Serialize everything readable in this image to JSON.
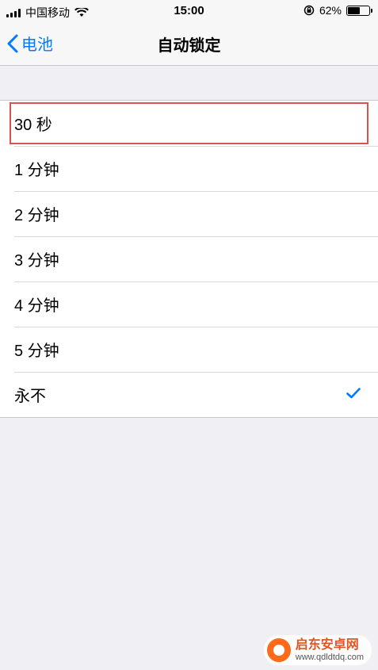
{
  "status_bar": {
    "carrier": "中国移动",
    "time": "15:00",
    "battery_percent_label": "62%",
    "battery_level": 0.62
  },
  "nav": {
    "back_label": "电池",
    "title": "自动锁定"
  },
  "options": [
    {
      "label": "30 秒",
      "selected": false,
      "highlighted": true
    },
    {
      "label": "1 分钟",
      "selected": false,
      "highlighted": false
    },
    {
      "label": "2 分钟",
      "selected": false,
      "highlighted": false
    },
    {
      "label": "3 分钟",
      "selected": false,
      "highlighted": false
    },
    {
      "label": "4 分钟",
      "selected": false,
      "highlighted": false
    },
    {
      "label": "5 分钟",
      "selected": false,
      "highlighted": false
    },
    {
      "label": "永不",
      "selected": true,
      "highlighted": false
    }
  ],
  "watermark": {
    "name": "启东安卓网",
    "url": "www.qdldtdq.com"
  },
  "colors": {
    "accent": "#007aff",
    "highlight_border": "#d9534f",
    "background": "#efeff4"
  },
  "icons": [
    "signal-icon",
    "wifi-icon",
    "orientation-lock-icon",
    "battery-icon",
    "chevron-left-icon",
    "checkmark-icon"
  ]
}
